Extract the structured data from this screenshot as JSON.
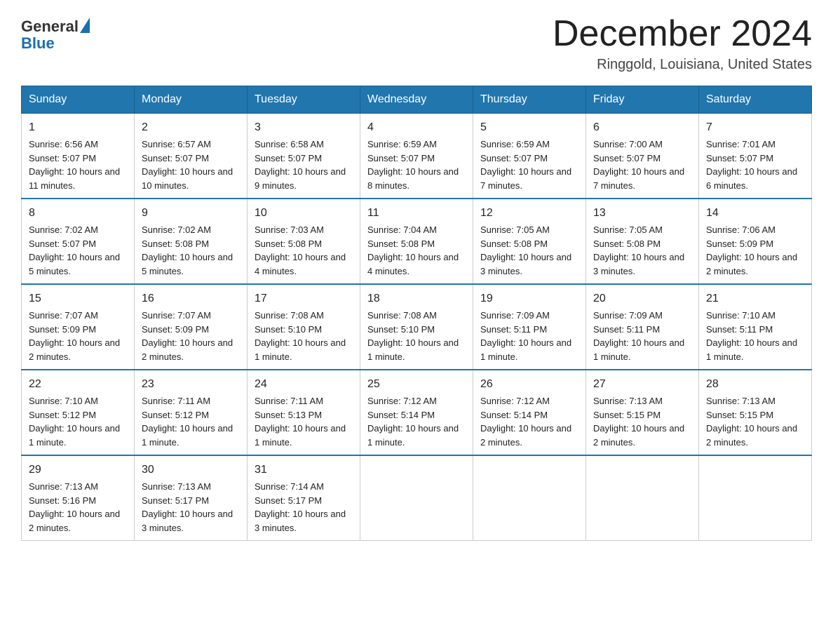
{
  "header": {
    "logo_general": "General",
    "logo_blue": "Blue",
    "month_title": "December 2024",
    "location": "Ringgold, Louisiana, United States"
  },
  "days_of_week": [
    "Sunday",
    "Monday",
    "Tuesday",
    "Wednesday",
    "Thursday",
    "Friday",
    "Saturday"
  ],
  "weeks": [
    [
      {
        "day": "1",
        "sunrise": "6:56 AM",
        "sunset": "5:07 PM",
        "daylight": "10 hours and 11 minutes."
      },
      {
        "day": "2",
        "sunrise": "6:57 AM",
        "sunset": "5:07 PM",
        "daylight": "10 hours and 10 minutes."
      },
      {
        "day": "3",
        "sunrise": "6:58 AM",
        "sunset": "5:07 PM",
        "daylight": "10 hours and 9 minutes."
      },
      {
        "day": "4",
        "sunrise": "6:59 AM",
        "sunset": "5:07 PM",
        "daylight": "10 hours and 8 minutes."
      },
      {
        "day": "5",
        "sunrise": "6:59 AM",
        "sunset": "5:07 PM",
        "daylight": "10 hours and 7 minutes."
      },
      {
        "day": "6",
        "sunrise": "7:00 AM",
        "sunset": "5:07 PM",
        "daylight": "10 hours and 7 minutes."
      },
      {
        "day": "7",
        "sunrise": "7:01 AM",
        "sunset": "5:07 PM",
        "daylight": "10 hours and 6 minutes."
      }
    ],
    [
      {
        "day": "8",
        "sunrise": "7:02 AM",
        "sunset": "5:07 PM",
        "daylight": "10 hours and 5 minutes."
      },
      {
        "day": "9",
        "sunrise": "7:02 AM",
        "sunset": "5:08 PM",
        "daylight": "10 hours and 5 minutes."
      },
      {
        "day": "10",
        "sunrise": "7:03 AM",
        "sunset": "5:08 PM",
        "daylight": "10 hours and 4 minutes."
      },
      {
        "day": "11",
        "sunrise": "7:04 AM",
        "sunset": "5:08 PM",
        "daylight": "10 hours and 4 minutes."
      },
      {
        "day": "12",
        "sunrise": "7:05 AM",
        "sunset": "5:08 PM",
        "daylight": "10 hours and 3 minutes."
      },
      {
        "day": "13",
        "sunrise": "7:05 AM",
        "sunset": "5:08 PM",
        "daylight": "10 hours and 3 minutes."
      },
      {
        "day": "14",
        "sunrise": "7:06 AM",
        "sunset": "5:09 PM",
        "daylight": "10 hours and 2 minutes."
      }
    ],
    [
      {
        "day": "15",
        "sunrise": "7:07 AM",
        "sunset": "5:09 PM",
        "daylight": "10 hours and 2 minutes."
      },
      {
        "day": "16",
        "sunrise": "7:07 AM",
        "sunset": "5:09 PM",
        "daylight": "10 hours and 2 minutes."
      },
      {
        "day": "17",
        "sunrise": "7:08 AM",
        "sunset": "5:10 PM",
        "daylight": "10 hours and 1 minute."
      },
      {
        "day": "18",
        "sunrise": "7:08 AM",
        "sunset": "5:10 PM",
        "daylight": "10 hours and 1 minute."
      },
      {
        "day": "19",
        "sunrise": "7:09 AM",
        "sunset": "5:11 PM",
        "daylight": "10 hours and 1 minute."
      },
      {
        "day": "20",
        "sunrise": "7:09 AM",
        "sunset": "5:11 PM",
        "daylight": "10 hours and 1 minute."
      },
      {
        "day": "21",
        "sunrise": "7:10 AM",
        "sunset": "5:11 PM",
        "daylight": "10 hours and 1 minute."
      }
    ],
    [
      {
        "day": "22",
        "sunrise": "7:10 AM",
        "sunset": "5:12 PM",
        "daylight": "10 hours and 1 minute."
      },
      {
        "day": "23",
        "sunrise": "7:11 AM",
        "sunset": "5:12 PM",
        "daylight": "10 hours and 1 minute."
      },
      {
        "day": "24",
        "sunrise": "7:11 AM",
        "sunset": "5:13 PM",
        "daylight": "10 hours and 1 minute."
      },
      {
        "day": "25",
        "sunrise": "7:12 AM",
        "sunset": "5:14 PM",
        "daylight": "10 hours and 1 minute."
      },
      {
        "day": "26",
        "sunrise": "7:12 AM",
        "sunset": "5:14 PM",
        "daylight": "10 hours and 2 minutes."
      },
      {
        "day": "27",
        "sunrise": "7:13 AM",
        "sunset": "5:15 PM",
        "daylight": "10 hours and 2 minutes."
      },
      {
        "day": "28",
        "sunrise": "7:13 AM",
        "sunset": "5:15 PM",
        "daylight": "10 hours and 2 minutes."
      }
    ],
    [
      {
        "day": "29",
        "sunrise": "7:13 AM",
        "sunset": "5:16 PM",
        "daylight": "10 hours and 2 minutes."
      },
      {
        "day": "30",
        "sunrise": "7:13 AM",
        "sunset": "5:17 PM",
        "daylight": "10 hours and 3 minutes."
      },
      {
        "day": "31",
        "sunrise": "7:14 AM",
        "sunset": "5:17 PM",
        "daylight": "10 hours and 3 minutes."
      },
      null,
      null,
      null,
      null
    ]
  ],
  "labels": {
    "sunrise": "Sunrise: ",
    "sunset": "Sunset: ",
    "daylight": "Daylight: "
  }
}
